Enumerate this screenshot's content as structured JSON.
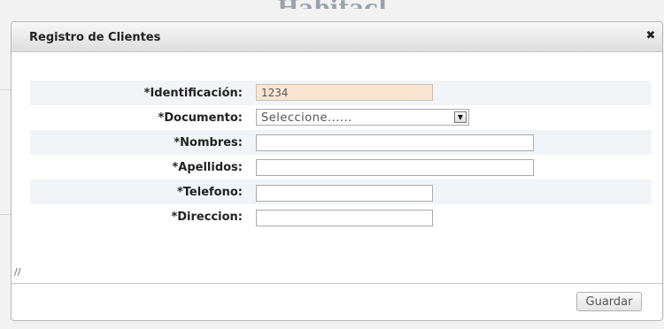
{
  "background": {
    "title": "Habitacl"
  },
  "dialog": {
    "title": "Registro de Clientes",
    "close_symbol": "✖",
    "resize_symbol": "//",
    "save_label": "Guardar"
  },
  "form": {
    "fields": [
      {
        "label": "*Identificación:",
        "value": "1234"
      },
      {
        "label": "*Documento:",
        "selected": "Seleccione......"
      },
      {
        "label": "*Nombres:",
        "value": ""
      },
      {
        "label": "*Apellidos:",
        "value": ""
      },
      {
        "label": "*Telefono:",
        "value": ""
      },
      {
        "label": "*Direccion:",
        "value": ""
      }
    ]
  }
}
